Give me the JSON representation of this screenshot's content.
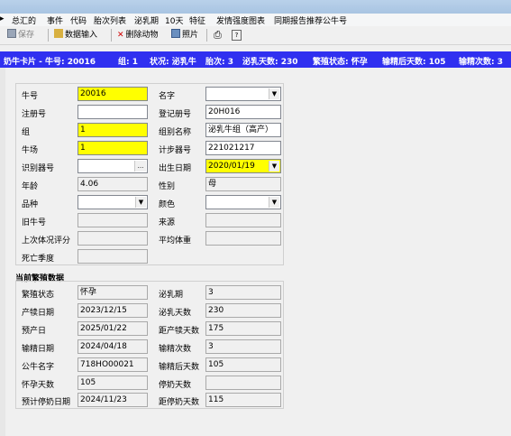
{
  "menu": [
    "总汇的",
    "事件",
    "代码",
    "胎次列表",
    "泌乳期",
    "10天",
    "特征",
    "发情强度图表",
    "同期报告推荐公牛号"
  ],
  "toolbar": {
    "save": "保存",
    "data_input": "数据输入",
    "delete_animal": "删除动物",
    "photo": "照片"
  },
  "banner": {
    "cow_card": "奶牛卡片 - 牛号: 20016",
    "group": "组: 1",
    "status": "状况: 泌乳牛",
    "parity": "胎次: 3",
    "dim": "泌乳天数: 230",
    "repro_status": "繁殖状态: 怀孕",
    "days_since_insem": "输精后天数: 105",
    "insem_count": "输精次数: 3"
  },
  "form": {
    "cow_id": {
      "label": "牛号",
      "value": "20016"
    },
    "name": {
      "label": "名字",
      "value": ""
    },
    "reg_no": {
      "label": "注册号",
      "value": ""
    },
    "reg_number2": {
      "label": "登记册号",
      "value": "20H016"
    },
    "group": {
      "label": "组",
      "value": "1"
    },
    "group_name": {
      "label": "组别名称",
      "value": "泌乳牛组（高产）"
    },
    "farm": {
      "label": "牛场",
      "value": "1"
    },
    "pedometer": {
      "label": "计步器号",
      "value": "221021217"
    },
    "id_no": {
      "label": "识别器号",
      "value": "",
      "btn": "..."
    },
    "birth_date": {
      "label": "出生日期",
      "value": "2020/01/19"
    },
    "age": {
      "label": "年龄",
      "value": "4.06"
    },
    "sex": {
      "label": "性别",
      "value": "母"
    },
    "breed": {
      "label": "品种",
      "value": ""
    },
    "color": {
      "label": "颜色",
      "value": ""
    },
    "old_id": {
      "label": "旧牛号",
      "value": ""
    },
    "origin": {
      "label": "来源",
      "value": ""
    },
    "last_bcs": {
      "label": "上次体况评分",
      "value": ""
    },
    "avg_weight": {
      "label": "平均体重",
      "value": ""
    },
    "death_season": {
      "label": "死亡季度",
      "value": ""
    }
  },
  "breeding": {
    "title": "当前繁殖数据",
    "repro_status": {
      "label": "繁殖状态",
      "value": "怀孕"
    },
    "lact_period": {
      "label": "泌乳期",
      "value": "3"
    },
    "calving_date": {
      "label": "产犊日期",
      "value": "2023/12/15"
    },
    "dim": {
      "label": "泌乳天数",
      "value": "230"
    },
    "due_date": {
      "label": "预产日",
      "value": "2025/01/22"
    },
    "days_to_calving": {
      "label": "距产犊天数",
      "value": "175"
    },
    "insem_date": {
      "label": "输精日期",
      "value": "2024/04/18"
    },
    "insem_count": {
      "label": "输精次数",
      "value": "3"
    },
    "sire_name": {
      "label": "公牛名字",
      "value": "718HO00021"
    },
    "days_after_insem": {
      "label": "输精后天数",
      "value": "105"
    },
    "pregnant_days": {
      "label": "怀孕天数",
      "value": "105"
    },
    "dry_days": {
      "label": "停奶天数",
      "value": ""
    },
    "planned_dry_date": {
      "label": "预计停奶日期",
      "value": "2024/11/23"
    },
    "days_to_dry": {
      "label": "距停奶天数",
      "value": "115"
    }
  },
  "colors": {
    "banner": "#3030f0",
    "highlight": "#ffff00"
  }
}
